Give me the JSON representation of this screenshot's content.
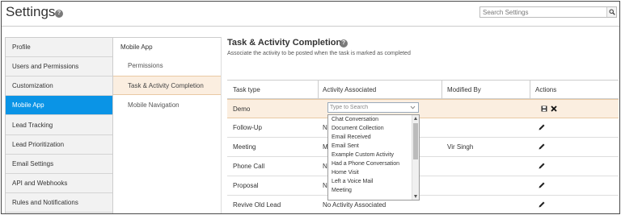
{
  "header": {
    "title": "Settings",
    "search_placeholder": "Search Settings"
  },
  "leftnav": {
    "items": [
      {
        "label": "Profile"
      },
      {
        "label": "Users and Permissions"
      },
      {
        "label": "Customization"
      },
      {
        "label": "Mobile App",
        "active": true
      },
      {
        "label": "Lead Tracking"
      },
      {
        "label": "Lead Prioritization"
      },
      {
        "label": "Email Settings"
      },
      {
        "label": "API and Webhooks"
      },
      {
        "label": "Rules and Notifications"
      }
    ]
  },
  "subnav": {
    "heading": "Mobile App",
    "items": [
      {
        "label": "Permissions"
      },
      {
        "label": "Task & Activity Completion",
        "active": true
      },
      {
        "label": "Mobile Navigation"
      }
    ]
  },
  "main": {
    "title": "Task & Activity Completion",
    "subtitle": "Associate the activity to be posted when the task is marked as completed"
  },
  "table": {
    "columns": [
      "Task type",
      "Activity Associated",
      "Modified By",
      "Actions"
    ],
    "rows": [
      {
        "task": "Demo",
        "activity": "",
        "modified_by": "",
        "editing": true
      },
      {
        "task": "Follow-Up",
        "activity": "N",
        "modified_by": ""
      },
      {
        "task": "Meeting",
        "activity": "M",
        "modified_by": "Vir Singh"
      },
      {
        "task": "Phone Call",
        "activity": "N",
        "modified_by": ""
      },
      {
        "task": "Proposal",
        "activity": "N",
        "modified_by": ""
      },
      {
        "task": "Revive Old Lead",
        "activity": "No Activity Associated",
        "modified_by": ""
      }
    ]
  },
  "dropdown": {
    "placeholder": "Type to Search",
    "options": [
      "Chat Conversation",
      "Document Collection",
      "Email Received",
      "Email Sent",
      "Example Custom Activity",
      "Had a Phone Conversation",
      "Home Visit",
      "Left a Voice Mail",
      "Meeting"
    ]
  },
  "colors": {
    "active_nav": "#0a94e6",
    "selected_row": "#fbeee0"
  }
}
